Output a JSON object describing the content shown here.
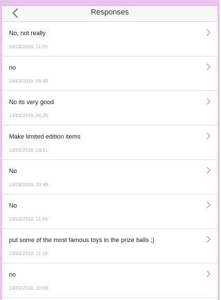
{
  "header": {
    "title": "Responses"
  },
  "responses": [
    {
      "text": "No, not really",
      "timestamp": "14/03/2018, 11:25"
    },
    {
      "text": "no",
      "timestamp": "14/03/2018, 09:40"
    },
    {
      "text": "No its very good",
      "timestamp": "14/03/2018, 00:26"
    },
    {
      "text": "Make limited edition items",
      "timestamp": "13/03/2018, 23:51"
    },
    {
      "text": "No",
      "timestamp": "13/03/2018, 23:49"
    },
    {
      "text": "No",
      "timestamp": "13/03/2018, 11:59"
    },
    {
      "text": "put some of the most famous toys in the prize balls ;)",
      "timestamp": "13/03/2018, 11:19"
    },
    {
      "text": "no",
      "timestamp": "13/03/2018, 10:00"
    }
  ],
  "colors": {
    "frame": "#e8c3ee",
    "header_bg": "#f7f7f7",
    "timestamp": "#a9b2bd",
    "divider": "#e4e4e4"
  },
  "icons": {
    "back": "chevron-left-icon",
    "row": "chevron-right-icon"
  }
}
